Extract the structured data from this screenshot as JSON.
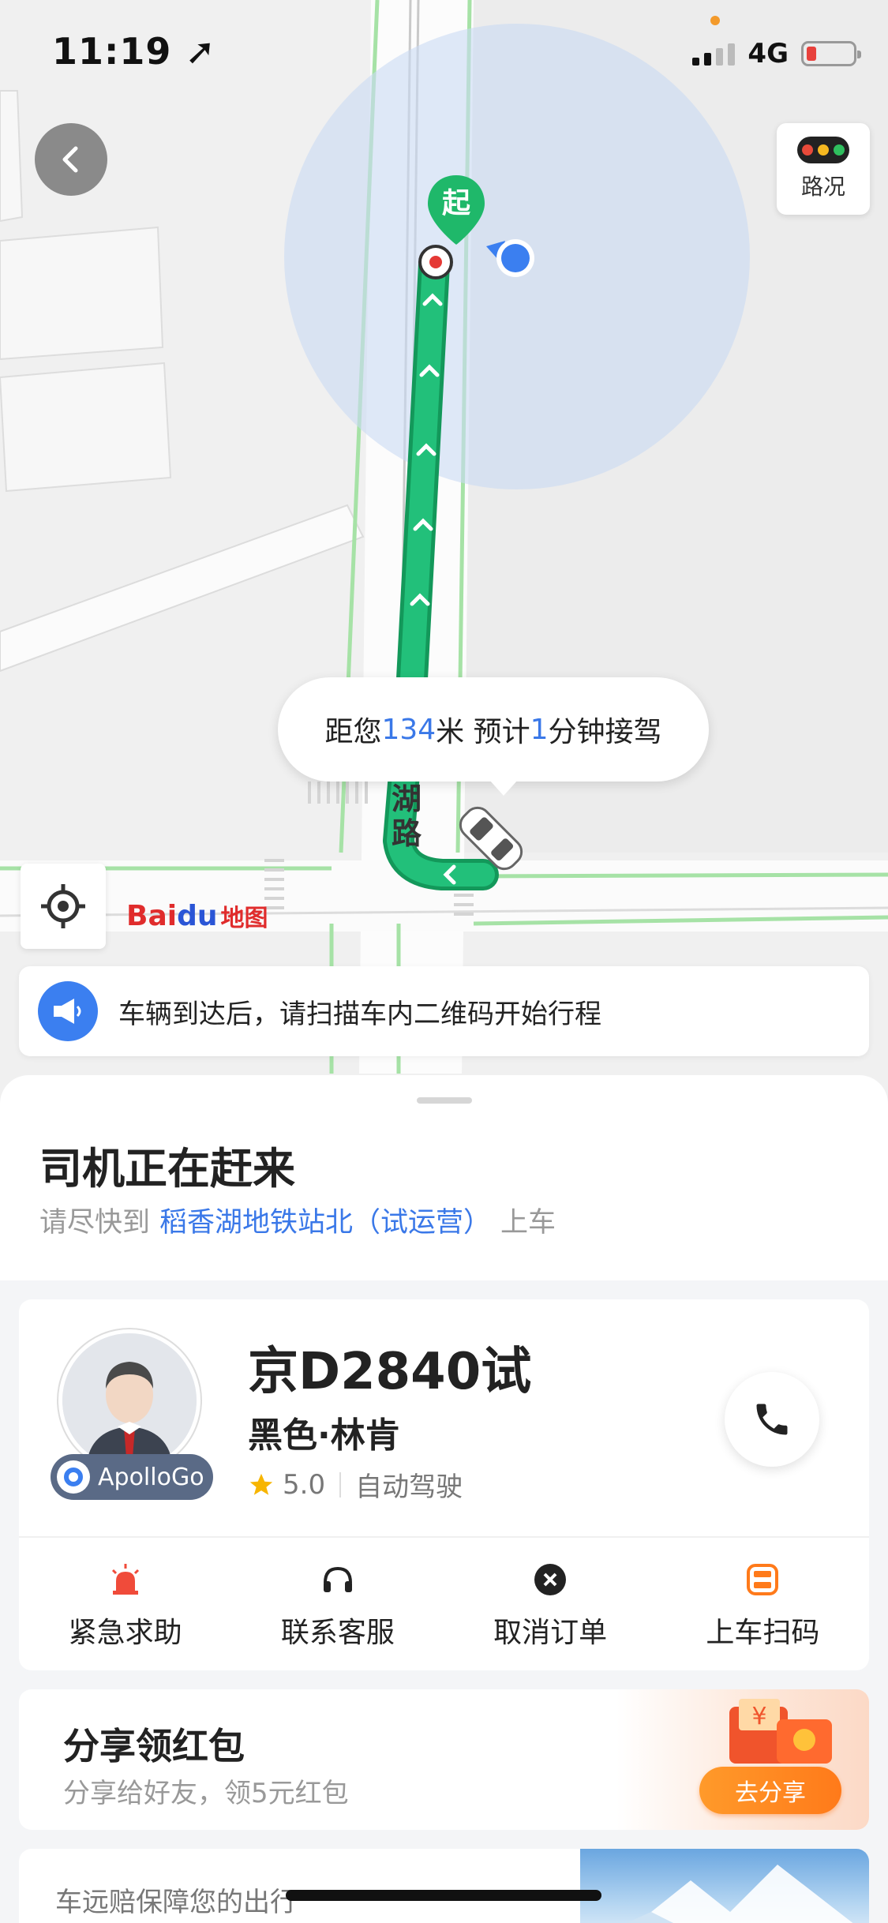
{
  "status_bar": {
    "time": "11:19",
    "network": "4G"
  },
  "map": {
    "traffic_label": "路况",
    "start_pin_label": "起",
    "road_name": "湖路",
    "logo": {
      "bai": "Bai",
      "du": "du",
      "ditu": "地图"
    },
    "eta": {
      "prefix": "距您",
      "distance": "134",
      "distance_unit": "米 预计",
      "minutes": "1",
      "suffix": "分钟接驾"
    },
    "notice": "车辆到达后，请扫描车内二维码开始行程"
  },
  "sheet": {
    "title": "司机正在赶来",
    "sub_prefix": "请尽快到",
    "pickup_location": "稻香湖地铁站北（试运营）",
    "sub_suffix": "上车"
  },
  "driver": {
    "badge": "ApolloGo",
    "plate": "京D2840试",
    "car_desc": "黑色·林肯",
    "rating": "5.0",
    "mode": "自动驾驶"
  },
  "actions": [
    {
      "label": "紧急求助",
      "icon": "alarm-icon",
      "color": "#f04b3a"
    },
    {
      "label": "联系客服",
      "icon": "headset-icon",
      "color": "#222222"
    },
    {
      "label": "取消订单",
      "icon": "cancel-icon",
      "color": "#222222"
    },
    {
      "label": "上车扫码",
      "icon": "scan-icon",
      "color": "#ff7a1a"
    }
  ],
  "share": {
    "title": "分享领红包",
    "subtitle": "分享给好友，领5元红包",
    "button": "去分享"
  },
  "insurance": {
    "text": "车远赔保障您的出行"
  },
  "colors": {
    "accent": "#3a78e8",
    "route": "#1fb86a",
    "orange": "#ff7a1a"
  }
}
